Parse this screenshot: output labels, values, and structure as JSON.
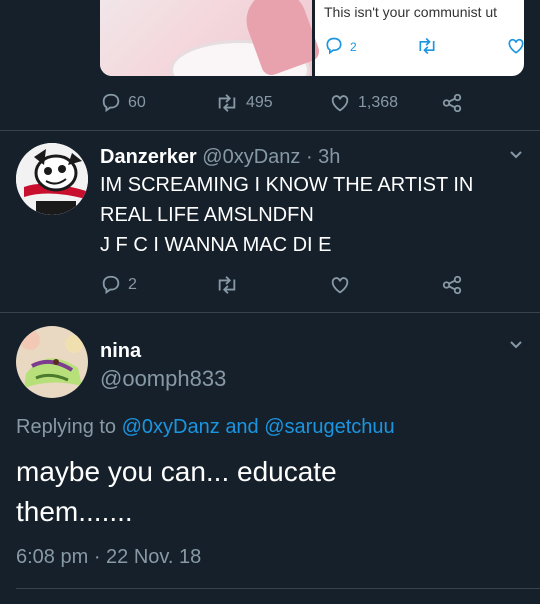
{
  "quoted_card": {
    "text": "This isn't your communist ut",
    "reply_count": "2"
  },
  "parent_tweet_stats": {
    "replies": "60",
    "retweets": "495",
    "likes": "1,368"
  },
  "reply": {
    "display_name": "Danzerker",
    "handle_time": "@0xyDanz · 3h",
    "text_lines": [
      "IM SCREAMING I KNOW THE ARTIST IN",
      "REAL LIFE AMSLNDFN",
      "J F C I WANNA MAC DI E"
    ],
    "reply_count": "2"
  },
  "main_tweet": {
    "display_name": "nina",
    "handle": "@oomph833",
    "replying_prefix": "Replying to",
    "replying_user1": "@0xyDanz",
    "replying_and": "and",
    "replying_user2": "@sarugetchuu",
    "text_line1": "maybe you can... educate",
    "text_line2": "them.......",
    "timestamp": "6:08 pm · 22 Nov. 18"
  },
  "colors": {
    "background": "#15202b",
    "muted": "#8899a6",
    "link": "#1b95e0",
    "text": "#ffffff"
  }
}
